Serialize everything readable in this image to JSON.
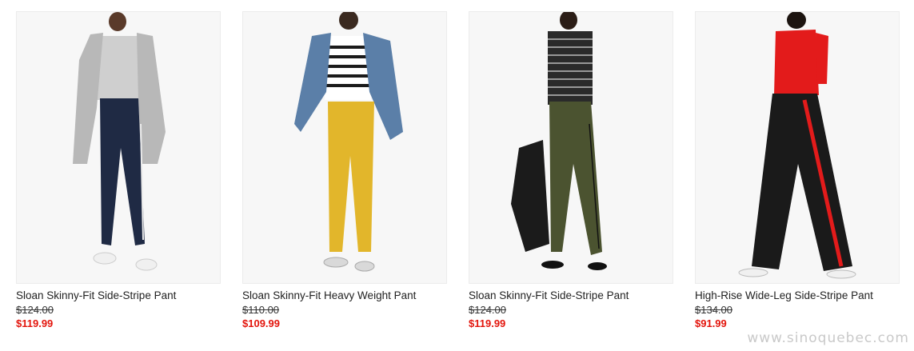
{
  "products": [
    {
      "name": "Sloan Skinny-Fit Side-Stripe Pant",
      "original_price": "$124.00",
      "sale_price": "$119.99",
      "image": "model-grey-coat-navy-pant"
    },
    {
      "name": "Sloan Skinny-Fit Heavy Weight Pant",
      "original_price": "$110.00",
      "sale_price": "$109.99",
      "image": "model-denim-jacket-yellow-pant"
    },
    {
      "name": "Sloan Skinny-Fit Side-Stripe Pant",
      "original_price": "$124.00",
      "sale_price": "$119.99",
      "image": "model-striped-top-olive-pant"
    },
    {
      "name": "High-Rise Wide-Leg Side-Stripe Pant",
      "original_price": "$134.00",
      "sale_price": "$91.99",
      "image": "model-red-top-black-wide-pant"
    }
  ],
  "watermark": "www.sinoquebec.com",
  "colors": {
    "sale": "#e3140b",
    "text": "#222222"
  }
}
